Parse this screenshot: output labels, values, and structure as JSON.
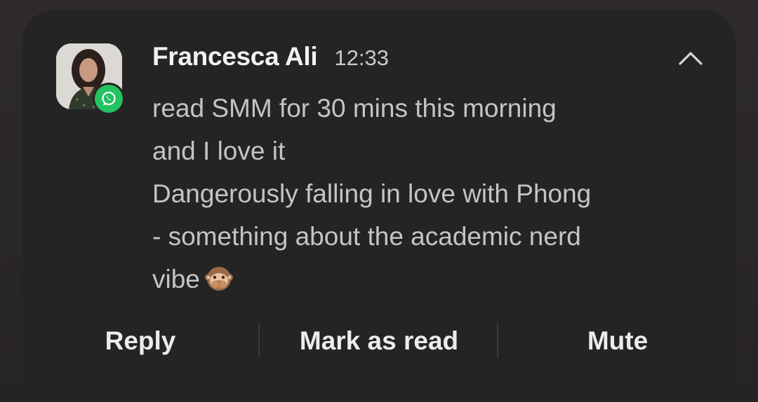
{
  "notification": {
    "sender": "Francesca Ali",
    "time": "12:33",
    "app_icon": "whatsapp-icon",
    "avatar": "contact-photo",
    "message_lines": [
      "read SMM for 30 mins this morning",
      "and I love it",
      "Dangerously falling in love with Phong",
      "- something about the academic nerd",
      "vibe"
    ],
    "emoji": "speak-no-evil-monkey",
    "collapse_icon": "chevron-up-icon"
  },
  "actions": {
    "reply": "Reply",
    "mark_as_read": "Mark as read",
    "mute": "Mute"
  },
  "colors": {
    "card_background": "#242424",
    "whatsapp_green": "#25c262",
    "primary_text": "#f2f2f2",
    "secondary_text": "#c4c4c4"
  }
}
